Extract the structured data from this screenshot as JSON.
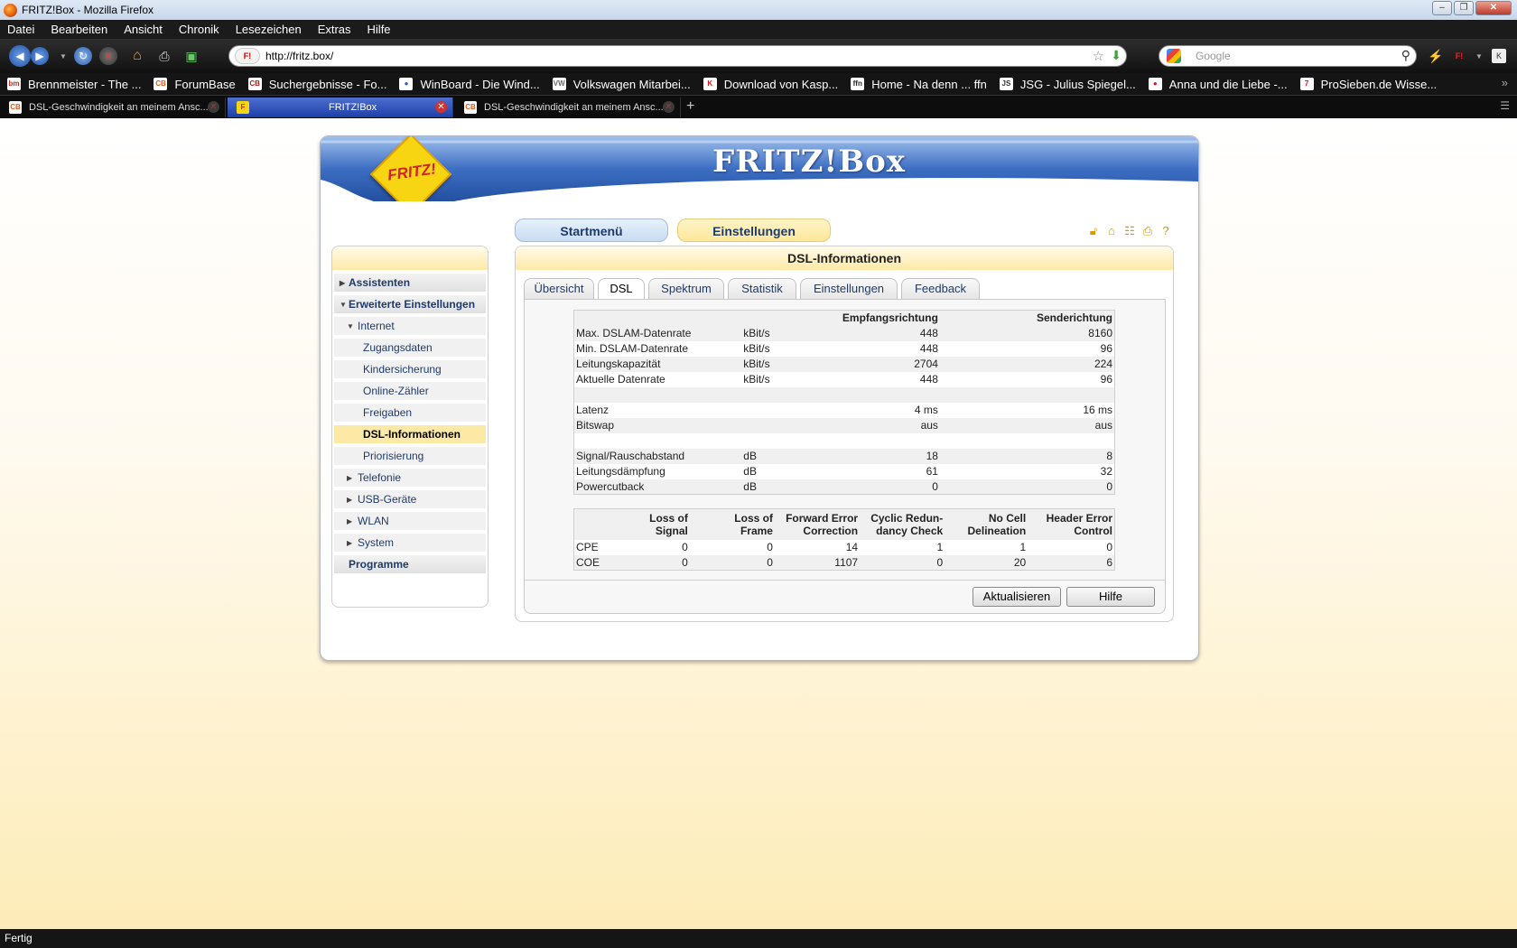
{
  "window": {
    "title": "FRITZ!Box - Mozilla Firefox",
    "controls": [
      "–",
      "❐",
      "✕"
    ]
  },
  "menu": [
    "Datei",
    "Bearbeiten",
    "Ansicht",
    "Chronik",
    "Lesezeichen",
    "Extras",
    "Hilfe"
  ],
  "navbar": {
    "url": "http://fritz.box/",
    "search_placeholder": "Google"
  },
  "bookmarks": [
    {
      "label": "Brennmeister - The ...",
      "icon": "bm",
      "color": "#c8261e"
    },
    {
      "label": "ForumBase",
      "icon": "CB",
      "color": "#e05a1b"
    },
    {
      "label": "Suchergebnisse - Fo...",
      "icon": "CB",
      "color": "#b01c1c"
    },
    {
      "label": "WinBoard - Die Wind...",
      "icon": "●",
      "color": "#2f5fbf"
    },
    {
      "label": "Volkswagen Mitarbei...",
      "icon": "VW",
      "color": "#6a6a6a"
    },
    {
      "label": "Download von Kasp...",
      "icon": "K",
      "color": "#d11b1b"
    },
    {
      "label": "Home - Na denn ... ffn",
      "icon": "ffn",
      "color": "#222222"
    },
    {
      "label": "JSG - Julius Spiegel...",
      "icon": "JS",
      "color": "#333333"
    },
    {
      "label": "Anna und die Liebe -...",
      "icon": "●",
      "color": "#d3163a"
    },
    {
      "label": "ProSieben.de Wisse...",
      "icon": "7",
      "color": "#d8121e"
    }
  ],
  "tabs": [
    {
      "label": "DSL-Geschwindigkeit an meinem Ansc...",
      "icon": "CB",
      "active": false
    },
    {
      "label": "FRITZ!Box",
      "icon": "F",
      "active": true
    },
    {
      "label": "DSL-Geschwindigkeit an meinem Ansc...",
      "icon": "CB",
      "active": false
    }
  ],
  "header": {
    "brand": "FRITZ!Box",
    "logo_text": "FRITZ!"
  },
  "main_tabs": {
    "start": "Startmenü",
    "settings": "Einstellungen"
  },
  "toolbar_icons": [
    "lock-icon",
    "home-icon",
    "tree-icon",
    "printer-icon",
    "help-icon"
  ],
  "sidebar": [
    {
      "label": "Assistenten",
      "level": 0,
      "arrow": "right"
    },
    {
      "label": "Erweiterte Einstellungen",
      "level": 0,
      "arrow": "down"
    },
    {
      "label": "Internet",
      "level": 1,
      "arrow": "down"
    },
    {
      "label": "Zugangsdaten",
      "level": 2
    },
    {
      "label": "Kindersicherung",
      "level": 2
    },
    {
      "label": "Online-Zähler",
      "level": 2
    },
    {
      "label": "Freigaben",
      "level": 2
    },
    {
      "label": "DSL-Informationen",
      "level": 2,
      "selected": true
    },
    {
      "label": "Priorisierung",
      "level": 2
    },
    {
      "label": "Telefonie",
      "level": 1,
      "arrow": "right"
    },
    {
      "label": "USB-Geräte",
      "level": 1,
      "arrow": "right"
    },
    {
      "label": "WLAN",
      "level": 1,
      "arrow": "right"
    },
    {
      "label": "System",
      "level": 1,
      "arrow": "right"
    },
    {
      "label": "Programme",
      "level": 0
    }
  ],
  "panel": {
    "title": "DSL-Informationen",
    "tabs": [
      "Übersicht",
      "DSL",
      "Spektrum",
      "Statistik",
      "Einstellungen",
      "Feedback"
    ],
    "active_tab": "DSL",
    "table1": {
      "headers": [
        "",
        "",
        "Empfangsrichtung",
        "Senderichtung"
      ],
      "rows": [
        [
          "Max. DSLAM-Datenrate",
          "kBit/s",
          "448",
          "8160"
        ],
        [
          "Min. DSLAM-Datenrate",
          "kBit/s",
          "448",
          "96"
        ],
        [
          "Leitungskapazität",
          "kBit/s",
          "2704",
          "224"
        ],
        [
          "Aktuelle Datenrate",
          "kBit/s",
          "448",
          "96"
        ],
        [
          "",
          "",
          "",
          ""
        ],
        [
          "Latenz",
          "",
          "4 ms",
          "16 ms"
        ],
        [
          "Bitswap",
          "",
          "aus",
          "aus"
        ],
        [
          "",
          "",
          "",
          ""
        ],
        [
          "Signal/Rauschabstand",
          "dB",
          "18",
          "8"
        ],
        [
          "Leitungsdämpfung",
          "dB",
          "61",
          "32"
        ],
        [
          "Powercutback",
          "dB",
          "0",
          "0"
        ]
      ]
    },
    "table2": {
      "headers": [
        [
          "",
          ""
        ],
        [
          "Loss of",
          "Signal"
        ],
        [
          "Loss of",
          "Frame"
        ],
        [
          "Forward Error",
          "Correction"
        ],
        [
          "Cyclic Redun-",
          "dancy Check"
        ],
        [
          "No Cell",
          "Delineation"
        ],
        [
          "Header Error",
          "Control"
        ]
      ],
      "rows": [
        [
          "CPE",
          "0",
          "0",
          "14",
          "1",
          "1",
          "0"
        ],
        [
          "COE",
          "0",
          "0",
          "1107",
          "0",
          "20",
          "6"
        ]
      ]
    },
    "buttons": {
      "refresh": "Aktualisieren",
      "help": "Hilfe"
    }
  },
  "status": "Fertig"
}
